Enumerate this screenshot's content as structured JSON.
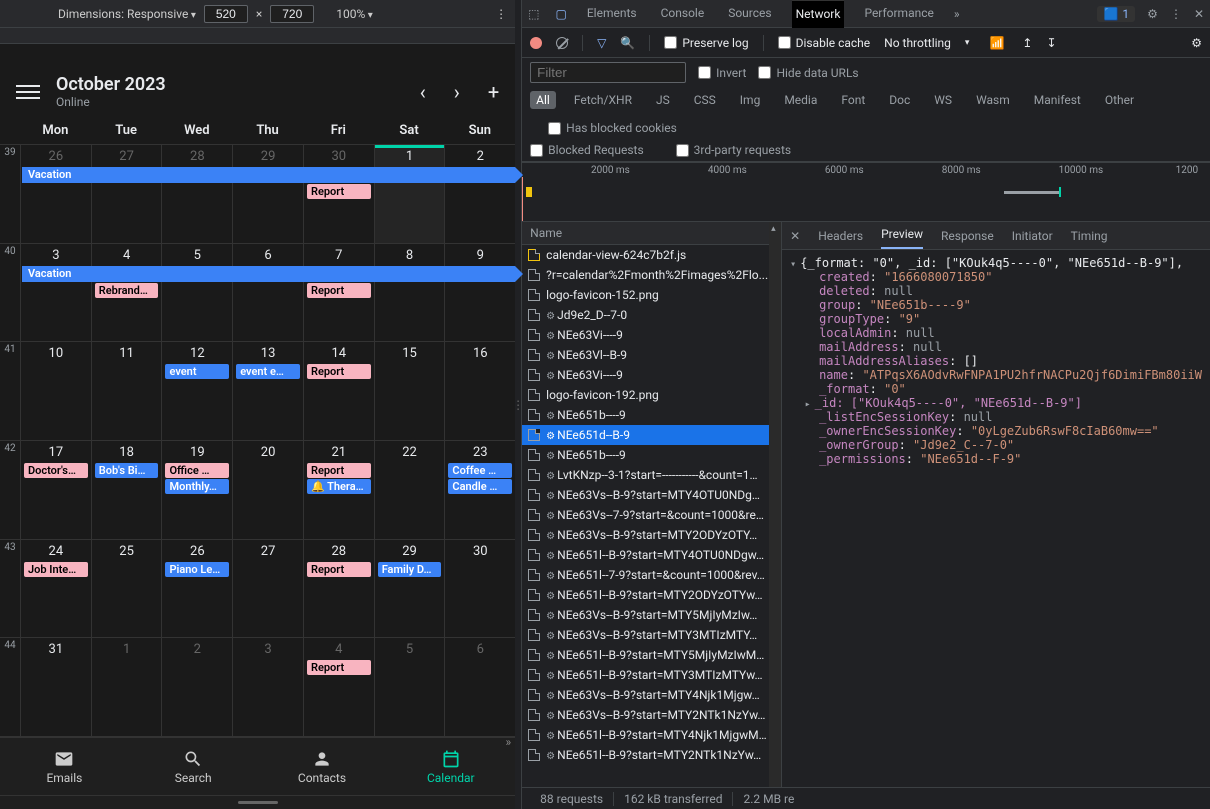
{
  "device_toolbar": {
    "dimensions_label": "Dimensions: Responsive",
    "width": "520",
    "height": "720",
    "zoom": "100%"
  },
  "app": {
    "title": "October 2023",
    "status": "Online",
    "weekdays": [
      "Mon",
      "Tue",
      "Wed",
      "Thu",
      "Fri",
      "Sat",
      "Sun"
    ],
    "weeks": [
      {
        "num": "39",
        "span_event": "Vacation",
        "days": [
          {
            "n": "26",
            "other": true
          },
          {
            "n": "27",
            "other": true
          },
          {
            "n": "28",
            "other": true
          },
          {
            "n": "29",
            "other": true
          },
          {
            "n": "30",
            "other": true,
            "events": [
              {
                "t": "Report",
                "c": "pink"
              }
            ]
          },
          {
            "n": "1",
            "today": true
          },
          {
            "n": "2"
          }
        ]
      },
      {
        "num": "40",
        "span_event": "Vacation",
        "days": [
          {
            "n": "3"
          },
          {
            "n": "4",
            "events": [
              {
                "t": "Rebrand…",
                "c": "pink"
              }
            ]
          },
          {
            "n": "5"
          },
          {
            "n": "6"
          },
          {
            "n": "7",
            "events": [
              {
                "t": "Report",
                "c": "pink"
              }
            ]
          },
          {
            "n": "8"
          },
          {
            "n": "9"
          }
        ]
      },
      {
        "num": "41",
        "days": [
          {
            "n": "10"
          },
          {
            "n": "11"
          },
          {
            "n": "12",
            "events": [
              {
                "t": "event",
                "c": "blue"
              }
            ]
          },
          {
            "n": "13",
            "events": [
              {
                "t": "event e…",
                "c": "blue"
              }
            ]
          },
          {
            "n": "14",
            "events": [
              {
                "t": "Report",
                "c": "pink"
              }
            ]
          },
          {
            "n": "15"
          },
          {
            "n": "16"
          }
        ]
      },
      {
        "num": "42",
        "days": [
          {
            "n": "17",
            "events": [
              {
                "t": "Doctor's…",
                "c": "pink"
              }
            ]
          },
          {
            "n": "18",
            "events": [
              {
                "t": "Bob's Bi…",
                "c": "blue"
              }
            ]
          },
          {
            "n": "19",
            "events": [
              {
                "t": "Office …",
                "c": "pink"
              },
              {
                "t": "Monthly…",
                "c": "blue"
              }
            ]
          },
          {
            "n": "20"
          },
          {
            "n": "21",
            "events": [
              {
                "t": "Report",
                "c": "pink"
              },
              {
                "t": "🔔 Therapy.",
                "c": "blue"
              }
            ]
          },
          {
            "n": "22"
          },
          {
            "n": "23",
            "events": [
              {
                "t": "Coffee …",
                "c": "blue"
              },
              {
                "t": "Candle …",
                "c": "blue"
              }
            ]
          }
        ]
      },
      {
        "num": "43",
        "days": [
          {
            "n": "24",
            "events": [
              {
                "t": "Job Inte…",
                "c": "pink"
              }
            ]
          },
          {
            "n": "25"
          },
          {
            "n": "26",
            "events": [
              {
                "t": "Piano Le…",
                "c": "blue"
              }
            ]
          },
          {
            "n": "27"
          },
          {
            "n": "28",
            "events": [
              {
                "t": "Report",
                "c": "pink"
              }
            ]
          },
          {
            "n": "29",
            "events": [
              {
                "t": "Family D…",
                "c": "blue"
              }
            ]
          },
          {
            "n": "30"
          }
        ]
      },
      {
        "num": "44",
        "days": [
          {
            "n": "31"
          },
          {
            "n": "1",
            "other": true
          },
          {
            "n": "2",
            "other": true
          },
          {
            "n": "3",
            "other": true
          },
          {
            "n": "4",
            "other": true,
            "events": [
              {
                "t": "Report",
                "c": "pink"
              }
            ]
          },
          {
            "n": "5",
            "other": true
          },
          {
            "n": "6",
            "other": true
          }
        ]
      }
    ],
    "nav": {
      "emails": "Emails",
      "search": "Search",
      "contacts": "Contacts",
      "calendar": "Calendar"
    }
  },
  "devtools": {
    "tabs": [
      "Elements",
      "Console",
      "Sources",
      "Network",
      "Performance"
    ],
    "active_tab": "Network",
    "issues": "1",
    "toolbar": {
      "preserve": "Preserve log",
      "disable": "Disable cache",
      "throttle": "No throttling"
    },
    "filter_placeholder": "Filter",
    "invert": "Invert",
    "hide": "Hide data URLs",
    "types": [
      "All",
      "Fetch/XHR",
      "JS",
      "CSS",
      "Img",
      "Media",
      "Font",
      "Doc",
      "WS",
      "Wasm",
      "Manifest",
      "Other"
    ],
    "blocked_cookies": "Has blocked cookies",
    "blocked_req": "Blocked Requests",
    "third_party": "3rd-party requests",
    "timeline_ticks": [
      "2000 ms",
      "4000 ms",
      "6000 ms",
      "8000 ms",
      "10000 ms",
      "1200"
    ],
    "name_hdr": "Name",
    "requests": [
      {
        "name": "calendar-view-624c7b2f.js",
        "type": "js"
      },
      {
        "name": "?r=calendar%2Fmonth%2Fimages%2Flo..."
      },
      {
        "name": "logo-favicon-152.png"
      },
      {
        "name": "Jd9e2_D--7-0",
        "gear": true
      },
      {
        "name": "NEe63Vi----9",
        "gear": true
      },
      {
        "name": "NEe63Vl--B-9",
        "gear": true
      },
      {
        "name": "NEe63Vi----9",
        "gear": true
      },
      {
        "name": "logo-favicon-192.png"
      },
      {
        "name": "NEe651b----9",
        "gear": true
      },
      {
        "name": "NEe651d--B-9",
        "gear": true,
        "selected": true
      },
      {
        "name": "NEe651b----9",
        "gear": true
      },
      {
        "name": "LvtKNzp--3-1?start=-----------&count=1…",
        "gear": true
      },
      {
        "name": "NEe63Vs--B-9?start=MTY4OTU0NDg…",
        "gear": true
      },
      {
        "name": "NEe63Vs--7-9?start=&count=1000&re…",
        "gear": true
      },
      {
        "name": "NEe63Vs--B-9?start=MTY2ODYzOTY…",
        "gear": true
      },
      {
        "name": "NEe651l--B-9?start=MTY4OTU0NDgw…",
        "gear": true
      },
      {
        "name": "NEe651l--7-9?start=&count=1000&rev…",
        "gear": true
      },
      {
        "name": "NEe651l--B-9?start=MTY2ODYzOTYw…",
        "gear": true
      },
      {
        "name": "NEe63Vs--B-9?start=MTY5MjIyMzIw…",
        "gear": true
      },
      {
        "name": "NEe63Vs--B-9?start=MTY3MTIzMTY…",
        "gear": true
      },
      {
        "name": "NEe651l--B-9?start=MTY5MjIyMzIwM…",
        "gear": true
      },
      {
        "name": "NEe651l--B-9?start=MTY3MTIzMTYw…",
        "gear": true
      },
      {
        "name": "NEe63Vs--B-9?start=MTY4Njk1Mjgw…",
        "gear": true
      },
      {
        "name": "NEe63Vs--B-9?start=MTY2NTk1NzYw…",
        "gear": true
      },
      {
        "name": "NEe651l--B-9?start=MTY4Njk1MjgwM…",
        "gear": true
      },
      {
        "name": "NEe651l--B-9?start=MTY2NTk1NzYw…",
        "gear": true
      }
    ],
    "detail_tabs": [
      "Headers",
      "Preview",
      "Response",
      "Initiator",
      "Timing"
    ],
    "detail_active": "Preview",
    "preview_lines": [
      {
        "indent": 0,
        "caret": "d",
        "raw": "{_format: \"0\", _id: [\"KOuk4q5----0\", \"NEe651d--B-9\"],"
      },
      {
        "indent": 1,
        "key": "created",
        "val": "\"1666080071850\"",
        "vc": "js"
      },
      {
        "indent": 1,
        "key": "deleted",
        "val": "null",
        "vc": "jn"
      },
      {
        "indent": 1,
        "key": "group",
        "val": "\"NEe651b----9\"",
        "vc": "js"
      },
      {
        "indent": 1,
        "key": "groupType",
        "val": "\"9\"",
        "vc": "js"
      },
      {
        "indent": 1,
        "key": "localAdmin",
        "val": "null",
        "vc": "jn"
      },
      {
        "indent": 1,
        "key": "mailAddress",
        "val": "null",
        "vc": "jn"
      },
      {
        "indent": 1,
        "key": "mailAddressAliases",
        "val": "[]",
        "vc": "je"
      },
      {
        "indent": 1,
        "key": "name",
        "val": "\"ATPqsX6AOdvRwFNPA1PU2hfrNACPu2Qjf6DimiFBm80iiW",
        "vc": "js"
      },
      {
        "indent": 1,
        "key": "_format",
        "val": "\"0\"",
        "vc": "js"
      },
      {
        "indent": 0,
        "caret": "r",
        "raw": "_id: [\"KOuk4q5----0\", \"NEe651d--B-9\"]"
      },
      {
        "indent": 1,
        "key": "_listEncSessionKey",
        "val": "null",
        "vc": "jn"
      },
      {
        "indent": 1,
        "key": "_ownerEncSessionKey",
        "val": "\"0yLgeZub6RswF8cIaB60mw==\"",
        "vc": "js"
      },
      {
        "indent": 1,
        "key": "_ownerGroup",
        "val": "\"Jd9e2_C--7-0\"",
        "vc": "js"
      },
      {
        "indent": 1,
        "key": "_permissions",
        "val": "\"NEe651d--F-9\"",
        "vc": "js"
      }
    ],
    "status": {
      "req": "88 requests",
      "xfer": "162 kB transferred",
      "res": "2.2 MB re"
    }
  }
}
